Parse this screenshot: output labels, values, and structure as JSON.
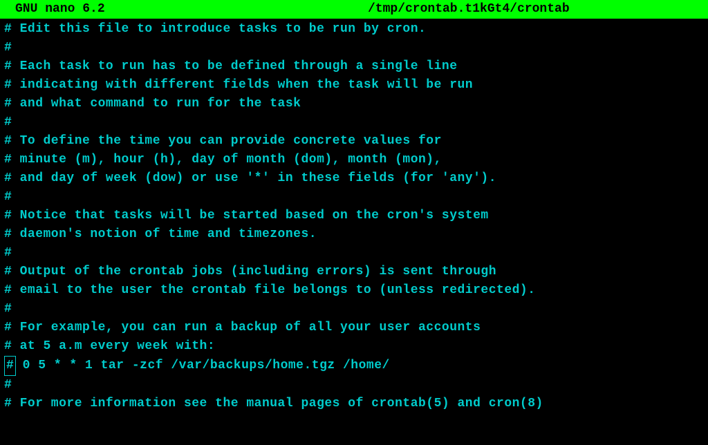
{
  "header": {
    "app_name": "GNU nano 6.2",
    "file_path": "/tmp/crontab.t1kGt4/crontab"
  },
  "lines": [
    "# Edit this file to introduce tasks to be run by cron.",
    "#",
    "# Each task to run has to be defined through a single line",
    "# indicating with different fields when the task will be run",
    "# and what command to run for the task",
    "#",
    "# To define the time you can provide concrete values for",
    "# minute (m), hour (h), day of month (dom), month (mon),",
    "# and day of week (dow) or use '*' in these fields (for 'any').",
    "#",
    "# Notice that tasks will be started based on the cron's system",
    "# daemon's notion of time and timezones.",
    "#",
    "# Output of the crontab jobs (including errors) is sent through",
    "# email to the user the crontab file belongs to (unless redirected).",
    "#",
    "# For example, you can run a backup of all your user accounts",
    "# at 5 a.m every week with:",
    "# 0 5 * * 1 tar -zcf /var/backups/home.tgz /home/",
    "#",
    "# For more information see the manual pages of crontab(5) and cron(8)"
  ],
  "cursor_line_index": 18,
  "cursor_char": "#",
  "cursor_rest": " 0 5 * * 1 tar -zcf /var/backups/home.tgz /home/"
}
